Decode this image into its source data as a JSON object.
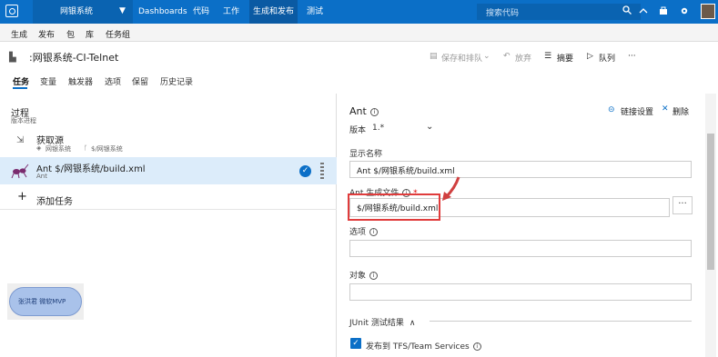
{
  "topbar": {
    "project": "网银系统",
    "nav": [
      "Dashboards",
      "代码",
      "工作",
      "生成和发布",
      "测试"
    ],
    "search_placeholder": "搜索代码"
  },
  "subnav": [
    "生成",
    "发布",
    "包",
    "库",
    "任务组"
  ],
  "titlebar": {
    "title": ":网银系统-CI-Telnet",
    "save": "保存和排队",
    "discard": "放弃",
    "summary": "摘要",
    "queue": "队列",
    "more": "···"
  },
  "tabs": [
    "任务",
    "变量",
    "触发器",
    "选项",
    "保留",
    "历史记录"
  ],
  "left": {
    "process_title": "过程",
    "process_sub": "版本进程",
    "get_sources": "获取源",
    "get_sources_repo": "网银系统",
    "get_sources_path": "$/网银系统",
    "task_title": "Ant $/网银系统/build.xml",
    "task_sub": "Ant",
    "add_task": "添加任务",
    "watermark": "张洪君  微软MVP"
  },
  "right": {
    "title": "Ant",
    "version_label": "版本",
    "version_value": "1.*",
    "link_settings": "链接设置",
    "delete": "删除",
    "display_name_label": "显示名称",
    "display_name_value": "Ant $/网银系统/build.xml",
    "ant_file_label": "Ant 生成文件",
    "ant_file_required": "*",
    "ant_file_value": "$/网银系统/build.xml",
    "options_label": "选项",
    "options_value": "",
    "targets_label": "对象",
    "targets_value": "",
    "junit_label": "JUnit 测试结果",
    "publish_label": "发布到 TFS/Team Services"
  }
}
